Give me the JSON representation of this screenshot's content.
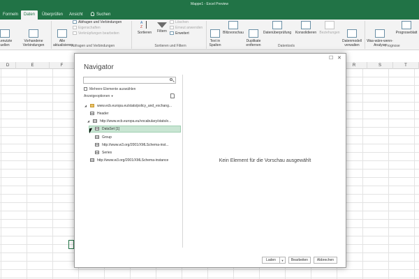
{
  "window": {
    "title": "Mappe1 - Excel Preview"
  },
  "ribbon_tabs": [
    {
      "label": "Formeln"
    },
    {
      "label": "Daten",
      "active": true
    },
    {
      "label": "Überprüfen"
    },
    {
      "label": "Ansicht"
    }
  ],
  "tell_me": {
    "label": "Suchen"
  },
  "ribbon": {
    "buttons": {
      "used_connections": "...enutzte\nuellen",
      "existing_connections": "Vorhandene\nVerbindungen",
      "refresh_all": "Alle\naktualisieren",
      "sort": "Sortieren",
      "filter": "Filtern",
      "text_to_columns": "Text in\nSpalten",
      "flash_fill": "Blitzvorschau",
      "remove_duplicates": "Duplikate\nentfernen",
      "data_validation": "Datenüberprüfung",
      "consolidate": "Konsolidieren",
      "relationships": "Beziehungen",
      "manage_data_model": "Datenmodell\nverwalten",
      "what_if": "Was-wäre-wenn-\nAnalyse",
      "forecast_sheet": "Prognoseblatt"
    },
    "small": {
      "queries_connections": "Abfragen und Verbindungen",
      "properties": "Eigenschaften",
      "edit_links": "Verknüpfungen bearbeiten",
      "clear": "Löschen",
      "reapply": "Erneut anwenden",
      "advanced": "Erweitert"
    },
    "groups": {
      "queries": "Abfragen und Verbindungen",
      "sort_filter": "Sortieren und Filtern",
      "data_tools": "Datentools",
      "forecast": "Prognose"
    }
  },
  "columns": [
    "D",
    "E",
    "F",
    "",
    "",
    "",
    "",
    "",
    "",
    "",
    "",
    "",
    "",
    "R",
    "S",
    "T"
  ],
  "navigator": {
    "title": "Navigator",
    "window_controls": {
      "restore": "☐",
      "close": "✕"
    },
    "search_placeholder": "",
    "multi_select_label": "Mehrere Elemente auswählen",
    "display_options_label": "Anzeigeoptionen",
    "tree": [
      {
        "label": "www.ecb.europa.eu/stats/policy_and_exchang...",
        "kind": "folder",
        "expanded": true
      },
      {
        "label": "Header",
        "kind": "table"
      },
      {
        "label": "http://www.ecb.europa.eu/vocabulary/stats/e...",
        "kind": "folder",
        "expanded": true
      },
      {
        "label": "DataSet [1]",
        "kind": "table",
        "selected": true
      },
      {
        "label": "Group",
        "kind": "table"
      },
      {
        "label": "http://www.w3.org/2001/XMLSchema-inst...",
        "kind": "table"
      },
      {
        "label": "Series",
        "kind": "table"
      },
      {
        "label": "http://www.w3.org/2001/XMLSchema-instance",
        "kind": "table"
      }
    ],
    "preview_empty": "Kein Element für die Vorschau ausgewählt",
    "buttons": {
      "load": "Laden",
      "edit": "Bearbeiten",
      "cancel": "Abbrechen"
    }
  }
}
